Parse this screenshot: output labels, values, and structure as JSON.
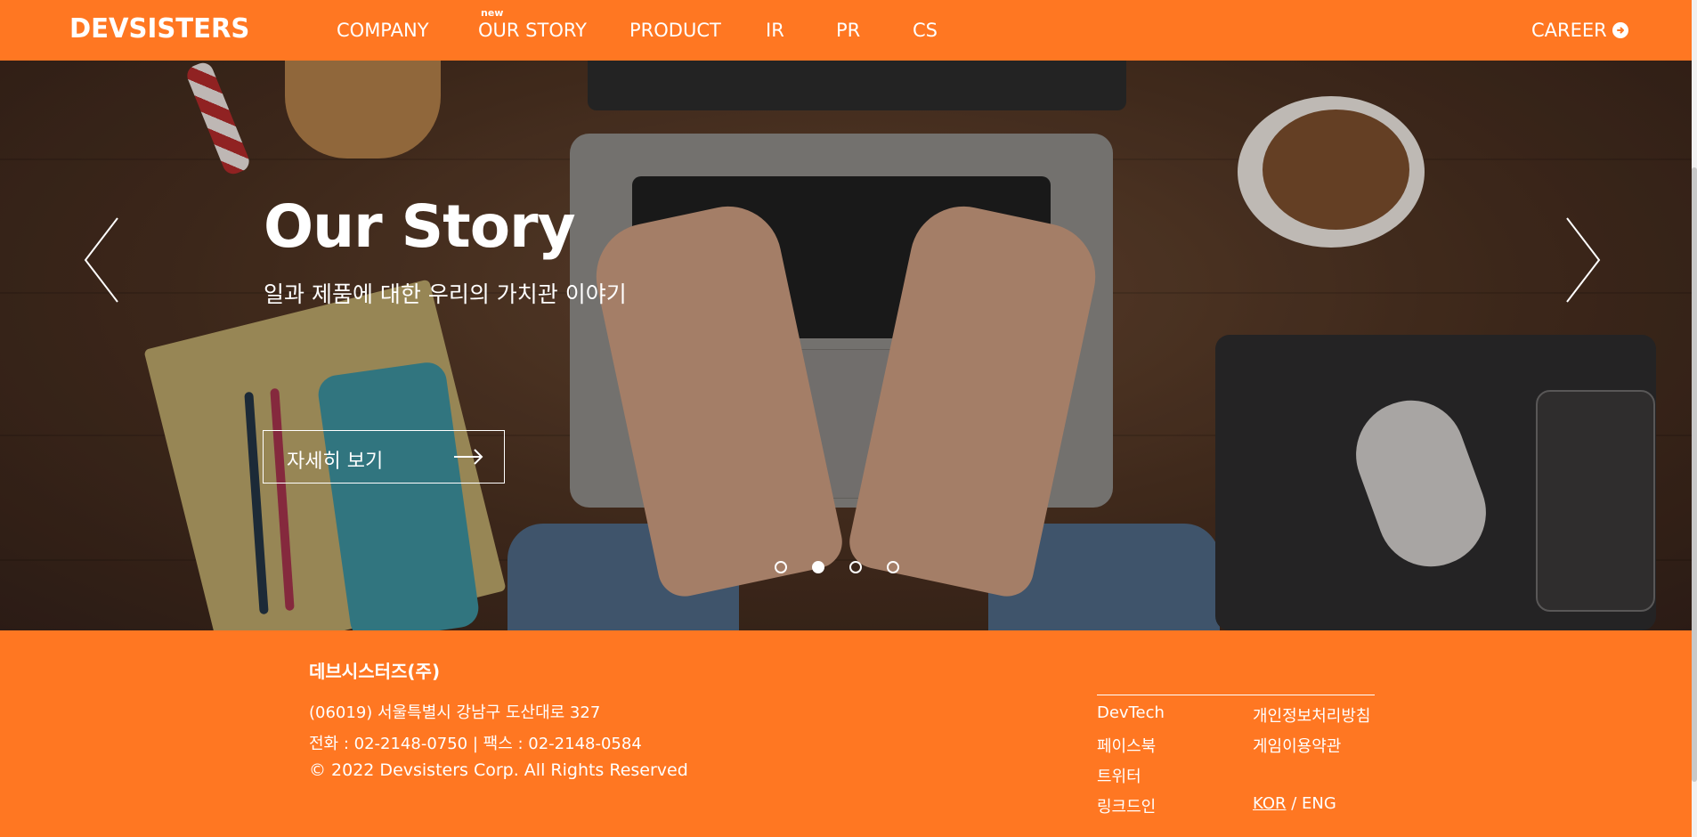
{
  "header": {
    "logo": "DEVSISTERS",
    "nav": [
      {
        "label": "COMPANY"
      },
      {
        "label": "OUR STORY",
        "badge": "new"
      },
      {
        "label": "PRODUCT"
      },
      {
        "label": "IR"
      },
      {
        "label": "PR"
      },
      {
        "label": "CS"
      }
    ],
    "career": "CAREER",
    "career_icon": "arrow-circle-right-icon",
    "brand_color": "#ff7722"
  },
  "hero": {
    "title": "Our Story",
    "subtitle": "일과 제품에 대한 우리의 가치관 이야기",
    "button_label": "자세히 보기",
    "button_icon": "arrow-right-icon",
    "prev_icon": "chevron-left-icon",
    "next_icon": "chevron-right-icon",
    "slide_count": 4,
    "active_slide": 2
  },
  "footer": {
    "company": "데브시스터즈(주)",
    "address": "(06019) 서울특별시 강남구 도산대로 327",
    "contact": "전화 : 02-2148-0750 | 팩스 : 02-2148-0584",
    "copyright": "© 2022 Devsisters Corp. All Rights Reserved",
    "links_left": [
      "DevTech",
      "페이스북",
      "트위터",
      "링크드인"
    ],
    "links_right": [
      "개인정보처리방침",
      "게임이용약관"
    ],
    "lang_kor": "KOR",
    "lang_sep": "/",
    "lang_eng": "ENG"
  }
}
